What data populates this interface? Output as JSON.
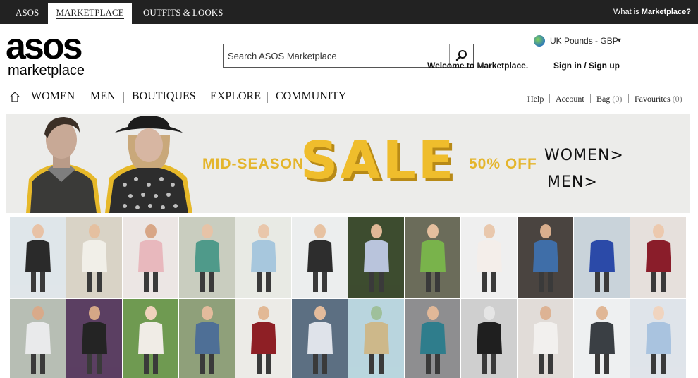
{
  "topbar": {
    "tabs": [
      "ASOS",
      "MARKETPLACE",
      "OUTFITS & LOOKS"
    ],
    "what_is_prefix": "What is ",
    "what_is_bold": "Marketplace?"
  },
  "logo": {
    "line1": "asos",
    "line2": "marketplace"
  },
  "search": {
    "placeholder": "Search ASOS Marketplace",
    "icon": "search-icon"
  },
  "currency": {
    "label": "UK Pounds - GBP",
    "caret": "▼",
    "icon": "globe-icon"
  },
  "welcome": "Welcome to Marketplace.",
  "account_link": "Sign in / Sign up",
  "nav": {
    "home_icon": "home-icon",
    "items": [
      "WOMEN",
      "MEN",
      "BOUTIQUES",
      "EXPLORE",
      "COMMUNITY"
    ]
  },
  "utility": {
    "help": "Help",
    "account": "Account",
    "bag": "Bag",
    "bag_count": "(0)",
    "favourites": "Favourites",
    "favourites_count": "(0)"
  },
  "banner": {
    "mid_season": "MID-SEASON",
    "sale": "SALE",
    "discount": "50% OFF",
    "links": [
      "WOMEN>",
      "MEN>"
    ]
  },
  "colors": {
    "topbar": "#222222",
    "sale_yellow": "#efbd2c",
    "sale_shadow": "#b88a17"
  },
  "grid": {
    "columns": 12,
    "rows": 2,
    "tiles": [
      {
        "bg": "#dfe6ea",
        "fg": "#2a2a2a",
        "skin": "#e8c2a6"
      },
      {
        "bg": "#d9d3c6",
        "fg": "#f1efe8",
        "skin": "#e5c0a0"
      },
      {
        "bg": "#ece6e4",
        "fg": "#e8b8bd",
        "skin": "#d8a686"
      },
      {
        "bg": "#c9cdbf",
        "fg": "#4f9a8a",
        "skin": "#e6c3a7"
      },
      {
        "bg": "#e8eae4",
        "fg": "#a7c7dd",
        "skin": "#e9c7ab"
      },
      {
        "bg": "#eceeee",
        "fg": "#2d2d2d",
        "skin": "#e7c2a2"
      },
      {
        "bg": "#3d4c2f",
        "fg": "#b9c4dc",
        "skin": "#e0b896"
      },
      {
        "bg": "#6b6c5a",
        "fg": "#79b34b",
        "skin": "#e5bf9e"
      },
      {
        "bg": "#efefef",
        "fg": "#f4eeea",
        "skin": "#e9c8ad"
      },
      {
        "bg": "#4a4440",
        "fg": "#3f6ea8",
        "skin": "#d9ae8d"
      },
      {
        "bg": "#c9d3da",
        "fg": "#2b4aa8",
        "skin": "#c9d3da"
      },
      {
        "bg": "#e6e0dc",
        "fg": "#8a1d2a",
        "skin": "#ecc9ae"
      },
      {
        "bg": "#b7beb4",
        "fg": "#e9eaeb",
        "skin": "#d8aa8a"
      },
      {
        "bg": "#5b3f62",
        "fg": "#242424",
        "skin": "#d5a786"
      },
      {
        "bg": "#6f9a51",
        "fg": "#f0ece6",
        "skin": "#f0d2bc"
      },
      {
        "bg": "#8fa07a",
        "fg": "#4e6f96",
        "skin": "#e3bb9c"
      },
      {
        "bg": "#ecebe7",
        "fg": "#8e1f25",
        "skin": "#e2b996"
      },
      {
        "bg": "#5c6f82",
        "fg": "#dfe3ea",
        "skin": "#e3bb9b"
      },
      {
        "bg": "#b9d5de",
        "fg": "#cdb88a",
        "skin": "#9fc09b"
      },
      {
        "bg": "#8e8e90",
        "fg": "#2f7d8c",
        "skin": "#e1b898"
      },
      {
        "bg": "#cfcfcf",
        "fg": "#1f1f1f",
        "skin": "#e5e5e5"
      },
      {
        "bg": "#e1dcd8",
        "fg": "#f2f0ee",
        "skin": "#ddb394"
      },
      {
        "bg": "#eef0f1",
        "fg": "#3a3f44",
        "skin": "#e0b796"
      },
      {
        "bg": "#dfe4ea",
        "fg": "#a9c3df",
        "skin": "#f0d4bf"
      }
    ]
  }
}
